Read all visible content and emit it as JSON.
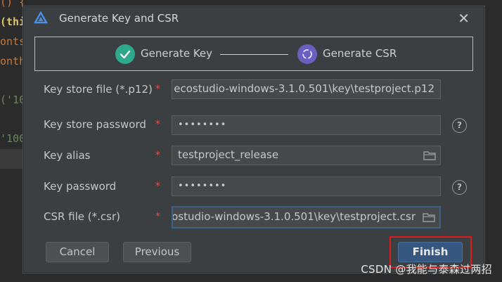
{
  "editor": {
    "lines": [
      "() {",
      "(this",
      "onts",
      "onth",
      "('10",
      "'100"
    ]
  },
  "dialog": {
    "title": "Generate Key and CSR",
    "close_icon": "close-icon",
    "steps": [
      {
        "label": "Generate Key",
        "icon": "check-icon",
        "color": "#2fa98c"
      },
      {
        "label": "Generate CSR",
        "icon": "refresh-icon",
        "color": "#6a5fc0"
      }
    ],
    "fields": {
      "key_store_file": {
        "label": "Key store file (*.p12)",
        "value": "ecostudio-windows-3.1.0.501\\key\\testproject.p12"
      },
      "key_store_password": {
        "label": "Key store password",
        "value": "••••••••"
      },
      "key_alias": {
        "label": "Key alias",
        "value": "testproject_release"
      },
      "key_password": {
        "label": "Key password",
        "value": "••••••••"
      },
      "csr_file": {
        "label": "CSR file (*.csr)",
        "value": "ostudio-windows-3.1.0.501\\key\\testproject.csr"
      }
    },
    "required_mark": "*",
    "help_mark": "?",
    "buttons": {
      "cancel": "Cancel",
      "previous": "Previous",
      "finish": "Finish"
    }
  },
  "watermark": "CSDN @我能与泰森过两招",
  "colors": {
    "dialog_bg": "#3c3f41",
    "required": "#d25252",
    "primary_button": "#365880",
    "highlight": "#e01b1b"
  }
}
